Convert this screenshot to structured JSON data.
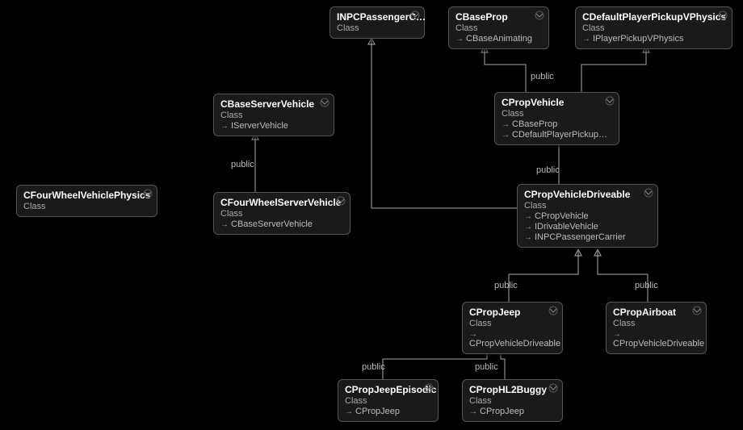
{
  "diagram_type": "class-hierarchy",
  "class_label": "Class",
  "edge_label": "public",
  "inherit_prefix": "→",
  "nodes": {
    "inpc": {
      "name": "INPCPassengerC…",
      "inherits": []
    },
    "cbaseprop": {
      "name": "CBaseProp",
      "inherits": [
        "CBaseAnimating"
      ]
    },
    "cdefault": {
      "name": "CDefaultPlayerPickupVPhysics",
      "inherits": [
        "IPlayerPickupVPhysics"
      ]
    },
    "cbaseservervehicle": {
      "name": "CBaseServerVehicle",
      "inherits": [
        "IServerVehicle"
      ]
    },
    "cpropvehicle": {
      "name": "CPropVehicle",
      "inherits": [
        "CBaseProp",
        "CDefaultPlayerPickup…"
      ]
    },
    "cfourphysics": {
      "name": "CFourWheelVehiclePhysics",
      "inherits": []
    },
    "cfourserver": {
      "name": "CFourWheelServerVehicle",
      "inherits": [
        "CBaseServerVehicle"
      ]
    },
    "cpropdriveable": {
      "name": "CPropVehicleDriveable",
      "inherits": [
        "CPropVehicle",
        "IDrivableVehicle",
        "INPCPassengerCarrier"
      ]
    },
    "cpropjeep": {
      "name": "CPropJeep",
      "inherits": [
        "CPropVehicleDriveable"
      ]
    },
    "cpropairboat": {
      "name": "CPropAirboat",
      "inherits": [
        "CPropVehicleDriveable"
      ]
    },
    "cpropjeepepisodic": {
      "name": "CPropJeepEpisodic",
      "inherits": [
        "CPropJeep"
      ]
    },
    "cprophl2buggy": {
      "name": "CPropHL2Buggy",
      "inherits": [
        "CPropJeep"
      ]
    }
  }
}
